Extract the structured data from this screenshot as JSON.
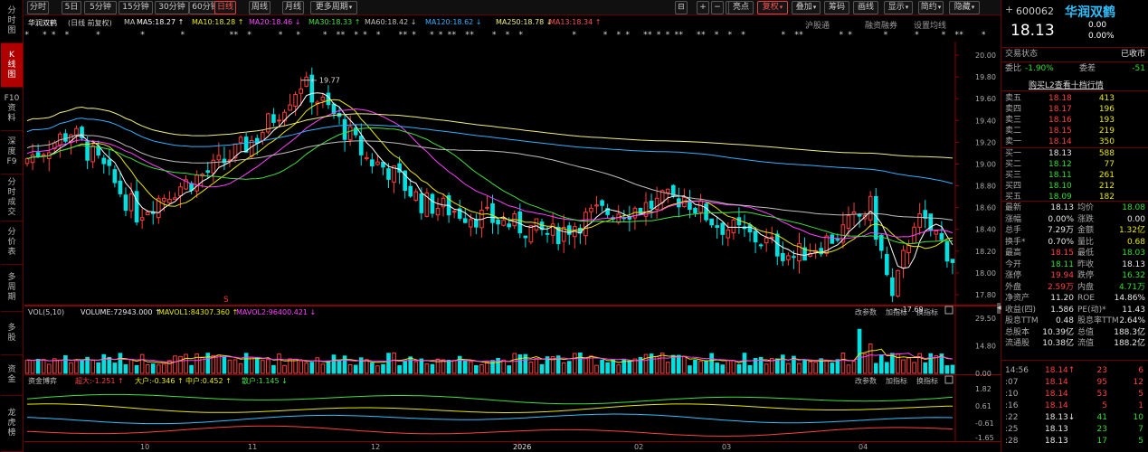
{
  "sidebar": {
    "tabs": [
      {
        "label": "分时图",
        "chars": [
          "分",
          "时",
          "图"
        ],
        "active": false
      },
      {
        "label": "K线图",
        "chars": [
          "K",
          "线",
          "图"
        ],
        "active": true
      },
      {
        "label": "F10资料",
        "chars": [
          "F10",
          "资",
          "料"
        ],
        "active": false
      },
      {
        "label": "深度F9",
        "chars": [
          "深",
          "度",
          "F9"
        ],
        "active": false
      },
      {
        "label": "分时成交",
        "chars": [
          "分",
          "时",
          "成",
          "交"
        ],
        "active": false
      },
      {
        "label": "分价表",
        "chars": [
          "分",
          "价",
          "表"
        ],
        "active": false
      },
      {
        "label": "多周期",
        "chars": [
          "多",
          "周",
          "期"
        ],
        "active": false
      },
      {
        "label": "多股",
        "chars": [
          "多",
          "股"
        ],
        "active": false
      },
      {
        "label": "资金",
        "chars": [
          "资",
          "金"
        ],
        "active": false
      },
      {
        "label": "龙虎榜",
        "chars": [
          "龙",
          "虎",
          "榜"
        ],
        "active": false
      }
    ]
  },
  "toolbar": {
    "periods": [
      "分时",
      "5日",
      "5分钟",
      "15分钟",
      "30分钟",
      "60分钟",
      "日线",
      "周线",
      "月线",
      "更多周期"
    ],
    "active_period": "日线",
    "right_buttons": [
      "叠加",
      "筹码",
      "画线",
      "显示",
      "简约",
      "隐藏"
    ],
    "bright_label": "亮点",
    "fuquan_label": "复权",
    "icon_labels": [
      "⊟",
      "+",
      "−",
      "□"
    ]
  },
  "title": {
    "stock": "华润双鹤",
    "mode": "(日线 前复权)",
    "ma_label": "MA",
    "ma": [
      {
        "name": "MA5",
        "value": "18.27",
        "arrow": "↑",
        "color": "#ffffff"
      },
      {
        "name": "MA10",
        "value": "18.28",
        "arrow": "↑",
        "color": "#e8e800"
      },
      {
        "name": "MA20",
        "value": "18.46",
        "arrow": "↓",
        "color": "#ff40ff"
      },
      {
        "name": "MA30",
        "value": "18.33",
        "arrow": "↑",
        "color": "#40e040"
      },
      {
        "name": "MA60",
        "value": "18.42",
        "arrow": "↓",
        "color": "#c0c0c0"
      },
      {
        "name": "MA120",
        "value": "18.62",
        "arrow": "↓",
        "color": "#30b0ff"
      },
      {
        "name": "MA250",
        "value": "18.78",
        "arrow": "↓",
        "color": "#f0f080"
      },
      {
        "name": "MA13",
        "value": "18.34",
        "arrow": "↑",
        "color": "#ff5050"
      }
    ]
  },
  "main_links": [
    "沪股通",
    "融资融券",
    "设置均线"
  ],
  "star_text": "*   * *  *      *         *        *          **  *      *   *     *  **  * *  *    ** *   * * **  **    *  *  *           *      *  * *   ** * * **   **  *  *  *        *  **        * *       *      *     *  **    *     *      *    *       **",
  "price_axis": [
    "20.00",
    "19.80",
    "19.60",
    "19.40",
    "19.20",
    "19.00",
    "18.80",
    "18.60",
    "18.40",
    "18.20",
    "18.00",
    "17.80"
  ],
  "annotations": {
    "high": "19.77",
    "low": "17.69",
    "s_marker": "S"
  },
  "vol": {
    "label": "VOL(5,10)",
    "volume": "VOLUME:72943.000",
    "arrow1": "↑",
    "mavol1": "MAVOL1:84307.360",
    "arrow2": "↑",
    "mavol2": "MAVOL2:96400.421",
    "arrow3": "↓",
    "links": [
      "改参数",
      "加指标",
      "换指标"
    ],
    "axis": [
      "29.50",
      "14.80",
      "0.00"
    ]
  },
  "fund": {
    "label": "资金博弈",
    "items": [
      {
        "text": "超大:-1.251",
        "arrow": "↑",
        "color": "#ff4040"
      },
      {
        "text": "大户:-0.346",
        "arrow": "↑",
        "color": "#e8e800"
      },
      {
        "text": "中户:0.452",
        "arrow": "↑",
        "color": "#e8e800"
      },
      {
        "text": "散户:1.145",
        "arrow": "↓",
        "color": "#40e040"
      }
    ],
    "links": [
      "改参数",
      "加指标",
      "换指标"
    ],
    "axis": [
      "1.82",
      "0.61",
      "-0.61",
      "-1.65"
    ]
  },
  "xaxis": [
    {
      "label": "10",
      "pos": 134
    },
    {
      "label": "11",
      "pos": 253
    },
    {
      "label": "12",
      "pos": 389
    },
    {
      "label": "2026",
      "pos": 546
    },
    {
      "label": "02",
      "pos": 680
    },
    {
      "label": "03",
      "pos": 777
    },
    {
      "label": "04",
      "pos": 928
    }
  ],
  "quote": {
    "code": "600062",
    "name": "华润双鹤",
    "price": "18.13",
    "change": "0.00",
    "pct": "0.00%",
    "status_label": "交易状态",
    "status": "已收市",
    "weibi_label": "委比",
    "weibi": "-1.90%",
    "weicha_label": "委差",
    "weicha": "-51",
    "buy_link": "购买L2查看十档行情",
    "asks": [
      {
        "label": "卖五",
        "price": "18.18",
        "vol": "413"
      },
      {
        "label": "卖四",
        "price": "18.17",
        "vol": "196"
      },
      {
        "label": "卖三",
        "price": "18.16",
        "vol": "193"
      },
      {
        "label": "卖二",
        "price": "18.15",
        "vol": "219"
      },
      {
        "label": "卖一",
        "price": "18.14",
        "vol": "350"
      }
    ],
    "bids": [
      {
        "label": "买一",
        "price": "18.13",
        "vol": "588"
      },
      {
        "label": "买二",
        "price": "18.12",
        "vol": "77"
      },
      {
        "label": "买三",
        "price": "18.11",
        "vol": "261"
      },
      {
        "label": "买四",
        "price": "18.10",
        "vol": "212"
      },
      {
        "label": "买五",
        "price": "18.09",
        "vol": "182"
      }
    ],
    "stats": [
      [
        "最新",
        "18.13",
        "wh",
        "均价",
        "18.08",
        "dn"
      ],
      [
        "涨幅",
        "0.00%",
        "wh",
        "涨跌",
        "0.00",
        "wh"
      ],
      [
        "总手",
        "7.29万",
        "wh",
        "金额",
        "1.32亿",
        "yl"
      ],
      [
        "换手*",
        "0.70%",
        "wh",
        "量比",
        "0.68",
        "yl"
      ],
      [
        "最高",
        "18.15",
        "up",
        "最低",
        "18.03",
        "dn"
      ],
      [
        "今开",
        "18.11",
        "dn",
        "昨收",
        "18.13",
        "wh"
      ],
      [
        "涨停",
        "19.94",
        "up",
        "跌停",
        "16.32",
        "dn"
      ],
      [
        "外盘",
        "2.59万",
        "up",
        "内盘",
        "4.71万",
        "dn"
      ],
      [
        "净资产",
        "11.20",
        "wh",
        "ROE",
        "14.86%",
        "wh"
      ],
      [
        "收益(四)",
        "1.586",
        "wh",
        "PE(动)*",
        "11.43",
        "wh"
      ],
      [
        "股息TTM",
        "0.48",
        "wh",
        "股息率TTM",
        "2.64%",
        "wh"
      ],
      [
        "总股本",
        "10.39亿",
        "wh",
        "总值",
        "188.3亿",
        "wh"
      ],
      [
        "流通股",
        "10.38亿",
        "wh",
        "流值",
        "188.2亿",
        "wh"
      ]
    ],
    "ticks": [
      {
        "time": "14:56",
        "price": "18.14",
        "arrow": "↑",
        "vol": "23",
        "num": "6",
        "pc": "up",
        "vc": "up"
      },
      {
        "time": ":07",
        "price": "18.14",
        "arrow": "",
        "vol": "95",
        "num": "12",
        "pc": "up",
        "vc": "up"
      },
      {
        "time": ":10",
        "price": "18.14",
        "arrow": "",
        "vol": "53",
        "num": "5",
        "pc": "up",
        "vc": "up"
      },
      {
        "time": ":16",
        "price": "18.14",
        "arrow": "",
        "vol": "5",
        "num": "1",
        "pc": "up",
        "vc": "up"
      },
      {
        "time": ":22",
        "price": "18.13",
        "arrow": "↓",
        "vol": "41",
        "num": "10",
        "pc": "wh",
        "vc": "dn"
      },
      {
        "time": ":25",
        "price": "18.13",
        "arrow": "",
        "vol": "23",
        "num": "7",
        "pc": "wh",
        "vc": "dn"
      },
      {
        "time": ":28",
        "price": "18.13",
        "arrow": "",
        "vol": "17",
        "num": "5",
        "pc": "wh",
        "vc": "dn"
      }
    ]
  },
  "colors": {
    "up": "#ff3c3c",
    "down": "#00e0e0",
    "ma5": "#ffffff",
    "ma10": "#e8e800",
    "ma20": "#ff40ff",
    "ma30": "#40e040",
    "ma60": "#c0c0c0",
    "ma120": "#30b0ff",
    "ma250": "#f0f080"
  }
}
